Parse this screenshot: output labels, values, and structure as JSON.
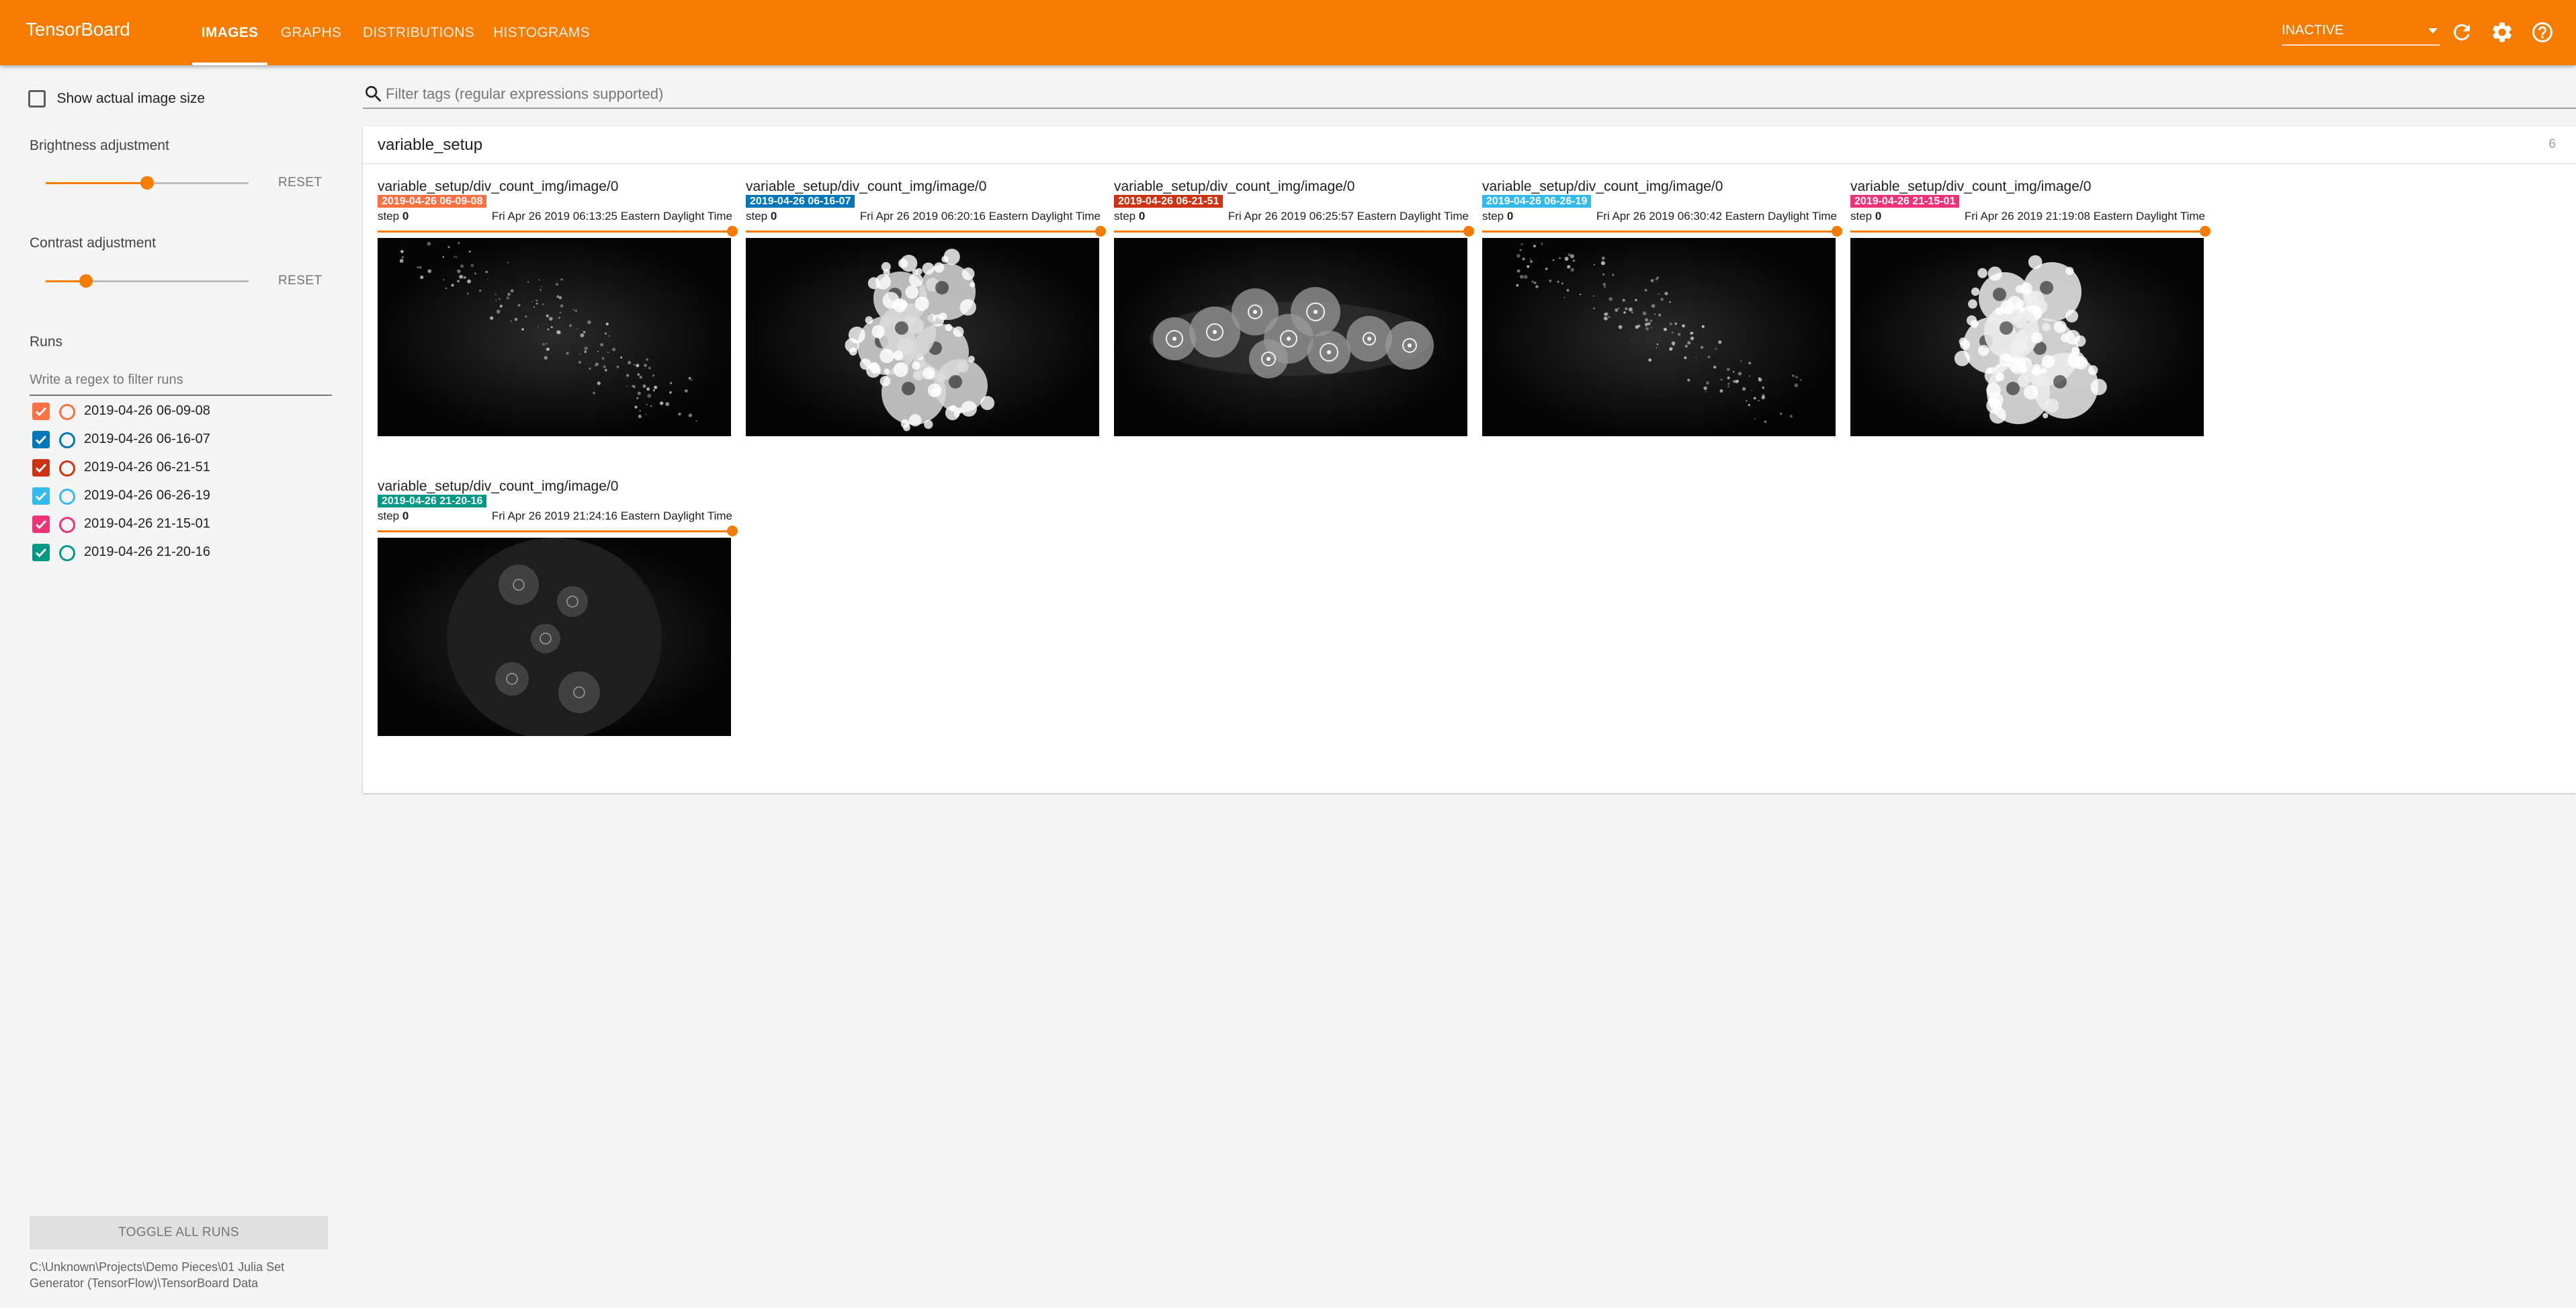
{
  "app": {
    "title": "TensorBoard",
    "tabs": [
      {
        "label": "IMAGES",
        "active": true
      },
      {
        "label": "GRAPHS",
        "active": false
      },
      {
        "label": "DISTRIBUTIONS",
        "active": false
      },
      {
        "label": "HISTOGRAMS",
        "active": false
      }
    ],
    "status_value": "INACTIVE",
    "accent_color": "#f57c00",
    "toolbar_icons": [
      "refresh-icon",
      "settings-icon",
      "help-icon"
    ]
  },
  "sidebar": {
    "show_actual_size_label": "Show actual image size",
    "show_actual_size_checked": false,
    "brightness": {
      "label": "Brightness adjustment",
      "reset_label": "RESET",
      "value": 0.5
    },
    "contrast": {
      "label": "Contrast adjustment",
      "reset_label": "RESET",
      "value": 0.2
    },
    "runs_label": "Runs",
    "run_filter_placeholder": "Write a regex to filter runs",
    "runs": [
      {
        "name": "2019-04-26 06-09-08",
        "color": "#ff7043",
        "checked": true
      },
      {
        "name": "2019-04-26 06-16-07",
        "color": "#0077bb",
        "checked": true
      },
      {
        "name": "2019-04-26 06-21-51",
        "color": "#cc3311",
        "checked": true
      },
      {
        "name": "2019-04-26 06-26-19",
        "color": "#33bbee",
        "checked": true
      },
      {
        "name": "2019-04-26 21-15-01",
        "color": "#ee3377",
        "checked": true
      },
      {
        "name": "2019-04-26 21-20-16",
        "color": "#009988",
        "checked": true
      }
    ],
    "toggle_all_label": "TOGGLE ALL RUNS",
    "logdir": "C:\\Unknown\\Projects\\Demo Pieces\\01 Julia Set Generator (TensorFlow)\\TensorBoard Data"
  },
  "main": {
    "filter_placeholder": "Filter tags (regular expressions supported)",
    "category": {
      "title": "variable_setup",
      "count": "6"
    },
    "images": [
      {
        "tag": "variable_setup/div_count_img/image/0",
        "run": "2019-04-26 06-09-08",
        "color": "#ff7043",
        "step_label": "step",
        "step": "0",
        "wall_time": "Fri Apr 26 2019 06:13:25 Eastern Daylight Time"
      },
      {
        "tag": "variable_setup/div_count_img/image/0",
        "run": "2019-04-26 06-16-07",
        "color": "#0077bb",
        "step_label": "step",
        "step": "0",
        "wall_time": "Fri Apr 26 2019 06:20:16 Eastern Daylight Time"
      },
      {
        "tag": "variable_setup/div_count_img/image/0",
        "run": "2019-04-26 06-21-51",
        "color": "#cc3311",
        "step_label": "step",
        "step": "0",
        "wall_time": "Fri Apr 26 2019 06:25:57 Eastern Daylight Time"
      },
      {
        "tag": "variable_setup/div_count_img/image/0",
        "run": "2019-04-26 06-26-19",
        "color": "#33bbee",
        "step_label": "step",
        "step": "0",
        "wall_time": "Fri Apr 26 2019 06:30:42 Eastern Daylight Time"
      },
      {
        "tag": "variable_setup/div_count_img/image/0",
        "run": "2019-04-26 21-15-01",
        "color": "#ee3377",
        "step_label": "step",
        "step": "0",
        "wall_time": "Fri Apr 26 2019 21:19:08 Eastern Daylight Time"
      },
      {
        "tag": "variable_setup/div_count_img/image/0",
        "run": "2019-04-26 21-20-16",
        "color": "#009988",
        "step_label": "step",
        "step": "0",
        "wall_time": "Fri Apr 26 2019 21:24:16 Eastern Daylight Time"
      }
    ]
  }
}
